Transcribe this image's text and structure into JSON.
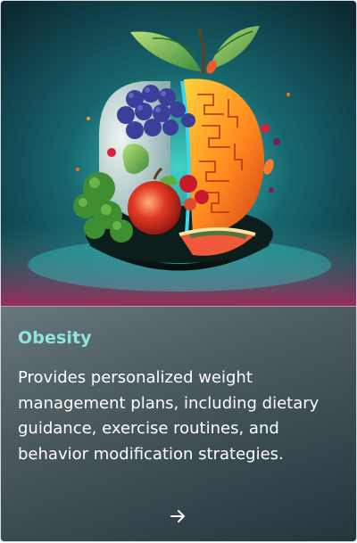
{
  "card": {
    "image_subject": "apple-made-of-fruits-and-vegetables",
    "title": "Obesity",
    "description": "Provides personalized weight management plans, including dietary guidance, exercise routines, and behavior modification strategies.",
    "link_icon": "arrow-right-icon",
    "colors": {
      "title": "#8fe6dd",
      "text": "#ffffff",
      "panel": "#3d4d51"
    }
  }
}
